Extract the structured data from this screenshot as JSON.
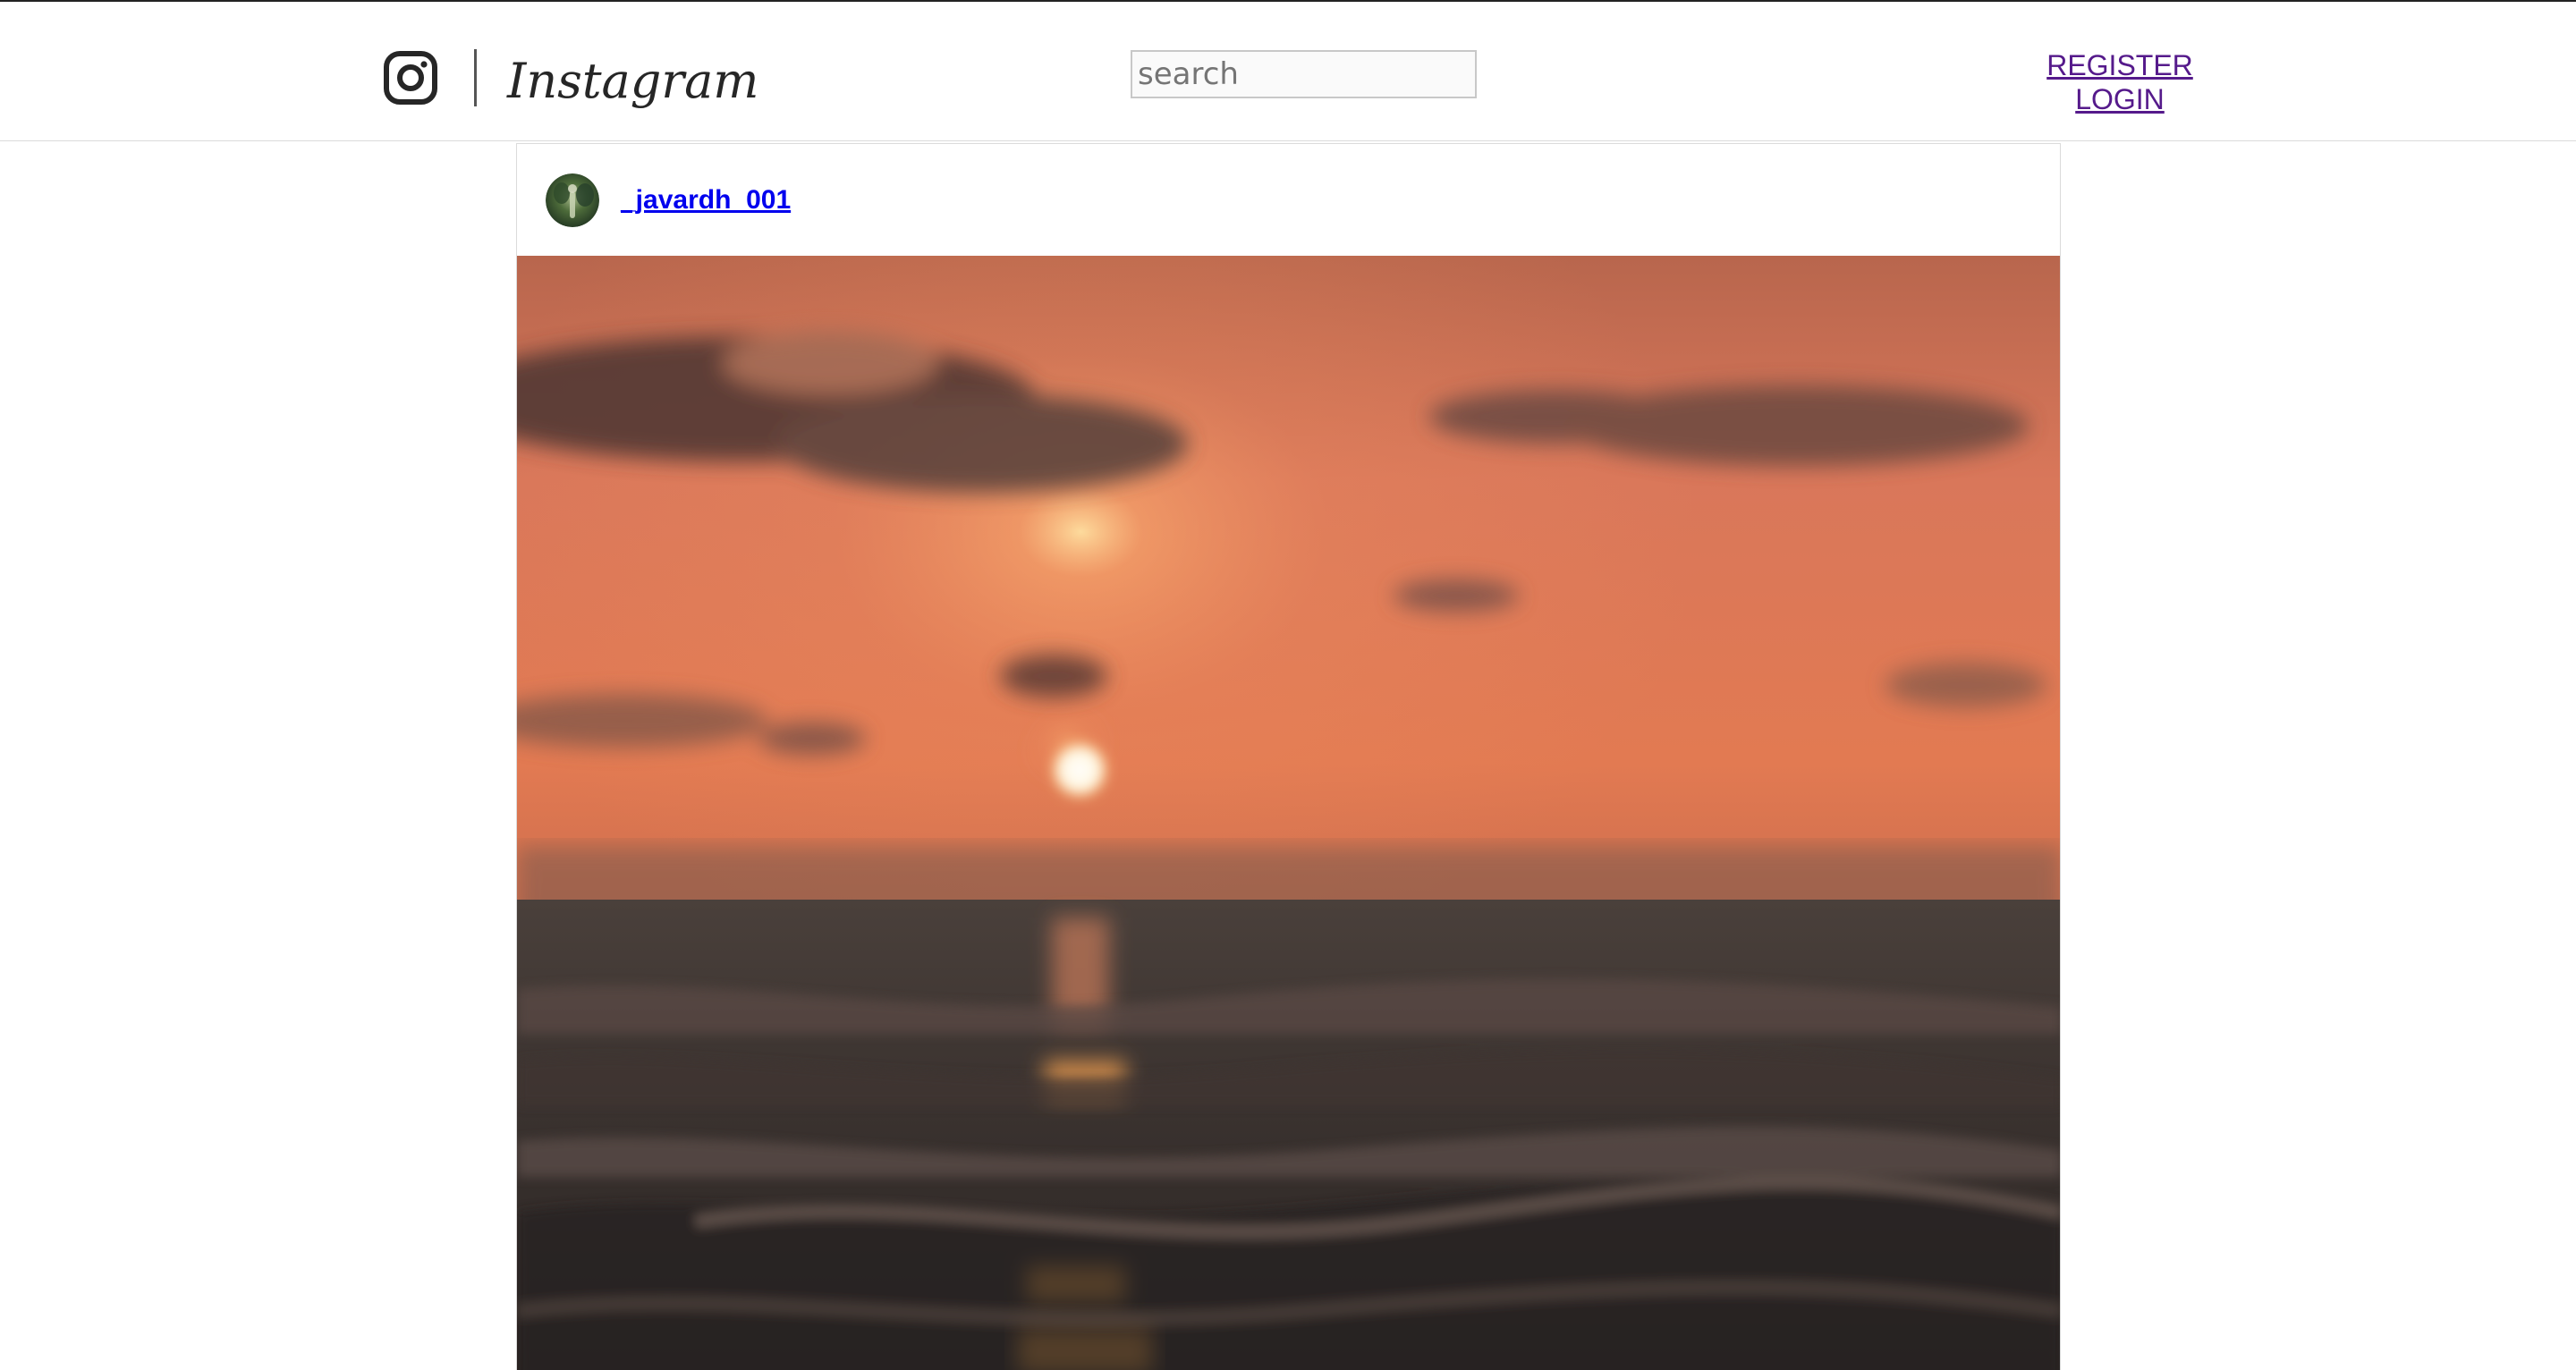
{
  "header": {
    "logo_wordmark": "Instagram",
    "logo_icon": "instagram-camera-icon",
    "search": {
      "placeholder": "search",
      "value": ""
    },
    "auth": {
      "register_label": "REGISTER",
      "login_label": "LOGIN"
    }
  },
  "post": {
    "username": "_javardh_001",
    "avatar": "avatar-image",
    "image": "sunset-over-ocean-photo"
  },
  "colors": {
    "link_visited": "#551a8b",
    "link": "#0000ee",
    "border": "#dbdbdb",
    "text": "#262626"
  }
}
